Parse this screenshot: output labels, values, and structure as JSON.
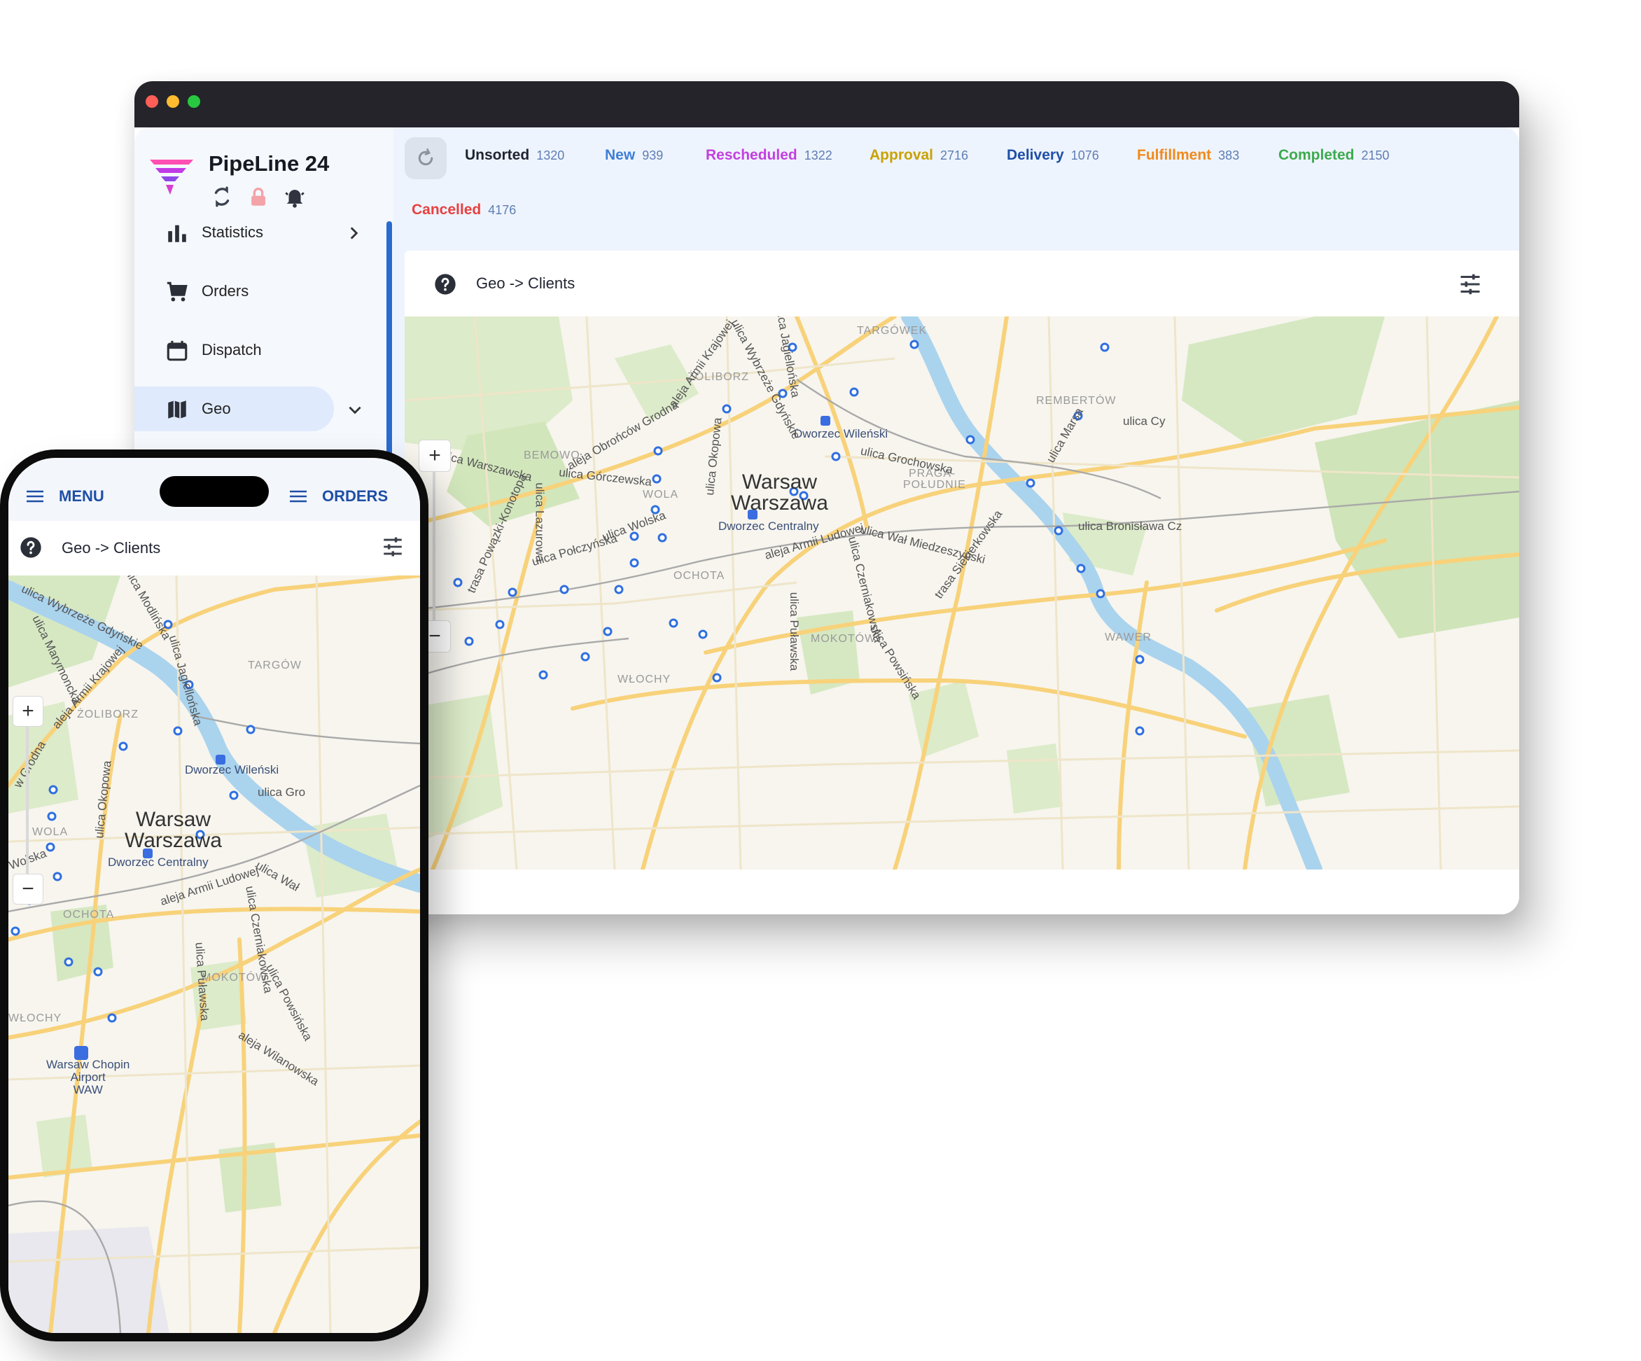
{
  "desktop": {
    "brand": {
      "name": "PipeLine 24"
    },
    "sidebar": {
      "items": [
        {
          "label": "Statistics",
          "icon": "bar-chart-icon"
        },
        {
          "label": "Orders",
          "icon": "cart-icon"
        },
        {
          "label": "Dispatch",
          "icon": "calendar-icon"
        },
        {
          "label": "Geo",
          "icon": "map-icon"
        }
      ]
    },
    "statuses": [
      {
        "label": "Unsorted",
        "count": "1320",
        "color": "#1f2430"
      },
      {
        "label": "New",
        "count": "939",
        "color": "#3f7fd6"
      },
      {
        "label": "Rescheduled",
        "count": "1322",
        "color": "#c33fe0"
      },
      {
        "label": "Approval",
        "count": "2716",
        "color": "#c9a200"
      },
      {
        "label": "Delivery",
        "count": "1076",
        "color": "#1f4fa6"
      },
      {
        "label": "Fulfillment",
        "count": "383",
        "color": "#f08a1c"
      },
      {
        "label": "Completed",
        "count": "2150",
        "color": "#3eaa4f"
      },
      {
        "label": "Cancelled",
        "count": "4176",
        "color": "#e84040"
      }
    ],
    "panel": {
      "title": "Geo -> Clients"
    },
    "map": {
      "zoom_in": "+",
      "zoom_out": "−",
      "city": [
        "Warsaw",
        "Warszawa"
      ],
      "districts": [
        "TARGÓWEK",
        "ŻOLIBORZ",
        "REMBERTÓW",
        "BEMOWO",
        "WOLA",
        "PRAGA-",
        "POŁUDNIE",
        "OCHOTA",
        "MOKOTÓW",
        "WAWER",
        "WŁOCHY"
      ],
      "stations": [
        "Dworzec Wileński",
        "Dworzec Centralny"
      ],
      "streets": [
        "aleja Armii Krajowej",
        "ulica Wybrzeże Gdyńskie",
        "ulica Jagiellońska",
        "aleja Obrońców Grodna",
        "ulica Warszawska",
        "ulica Górczewska",
        "ulica Okopowa",
        "ulica Grochowska",
        "trasa Powązki-Konotopa",
        "ulica Lazurowa",
        "ulica Wolska",
        "ulica Połczyńska",
        "aleja Armii Ludowej",
        "ulica Wał Miedzeszyński",
        "ulica Czerniakowska",
        "trasa Siekierkowska",
        "ulica Bronisława Cz",
        "ulica Puławska",
        "ulica Powsińska",
        "ulica Marsa",
        "ulica Cy"
      ]
    }
  },
  "phone": {
    "menu_label": "MENU",
    "orders_label": "ORDERS",
    "panel": {
      "title": "Geo -> Clients"
    },
    "map": {
      "zoom_in": "+",
      "zoom_out": "−",
      "city": [
        "Warsaw",
        "Warszawa"
      ],
      "districts": [
        "ŻOLIBORZ",
        "TARGÓW",
        "WOLA",
        "OCHOTA",
        "MOKOTÓW",
        "WŁOCHY"
      ],
      "stations": [
        "Dworzec Wileński",
        "Dworzec Centralny"
      ],
      "airport": [
        "Warsaw Chopin",
        "Airport",
        "WAW"
      ],
      "streets": [
        "ulica Wybrzeże Gdyńskie",
        "ulica Modlińska",
        "ulica Marymoncka",
        "aleja Armii Krajowej",
        "ulica Jagiellońska",
        "ulica Okopowa",
        "aleja Armii Ludowej",
        "ulica Czerniakowska",
        "ulica Puławska",
        "ulica Powsińska",
        "aleja Wilanowska",
        "ulica Wał",
        "ulica Gro",
        "Wolska",
        "w Grodna"
      ]
    }
  }
}
